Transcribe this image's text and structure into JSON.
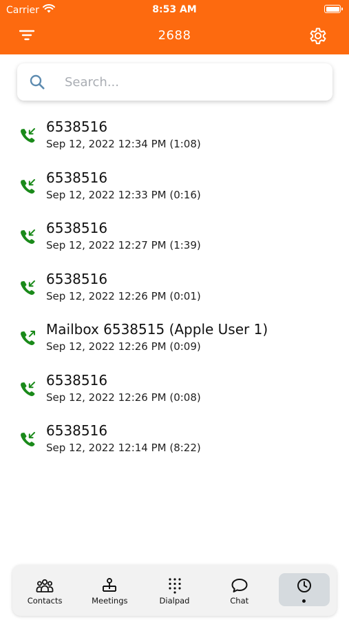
{
  "status_bar": {
    "carrier": "Carrier",
    "time": "8:53 AM"
  },
  "header": {
    "title": "2688",
    "background": "#fd6a0f"
  },
  "search": {
    "placeholder": "Search..."
  },
  "call_log": [
    {
      "direction": "incoming",
      "number": "6538516",
      "detail": "Sep 12, 2022 12:34 PM (1:08)"
    },
    {
      "direction": "incoming",
      "number": "6538516",
      "detail": "Sep 12, 2022 12:33 PM (0:16)"
    },
    {
      "direction": "incoming",
      "number": "6538516",
      "detail": "Sep 12, 2022 12:27 PM (1:39)"
    },
    {
      "direction": "incoming",
      "number": "6538516",
      "detail": "Sep 12, 2022 12:26 PM (0:01)"
    },
    {
      "direction": "outgoing",
      "number": "Mailbox 6538515 (Apple User 1)",
      "detail": "Sep 12, 2022 12:26 PM (0:09)"
    },
    {
      "direction": "incoming",
      "number": "6538516",
      "detail": "Sep 12, 2022 12:26 PM (0:08)"
    },
    {
      "direction": "incoming",
      "number": "6538516",
      "detail": "Sep 12, 2022 12:14 PM (8:22)"
    }
  ],
  "call_icon_color": "#1a8a1a",
  "tabs": [
    {
      "label": "Contacts",
      "icon": "contacts-icon"
    },
    {
      "label": "Meetings",
      "icon": "meetings-icon"
    },
    {
      "label": "Dialpad",
      "icon": "dialpad-icon"
    },
    {
      "label": "Chat",
      "icon": "chat-icon"
    },
    {
      "label": "",
      "icon": "recents-clock-icon",
      "selected": true
    }
  ]
}
